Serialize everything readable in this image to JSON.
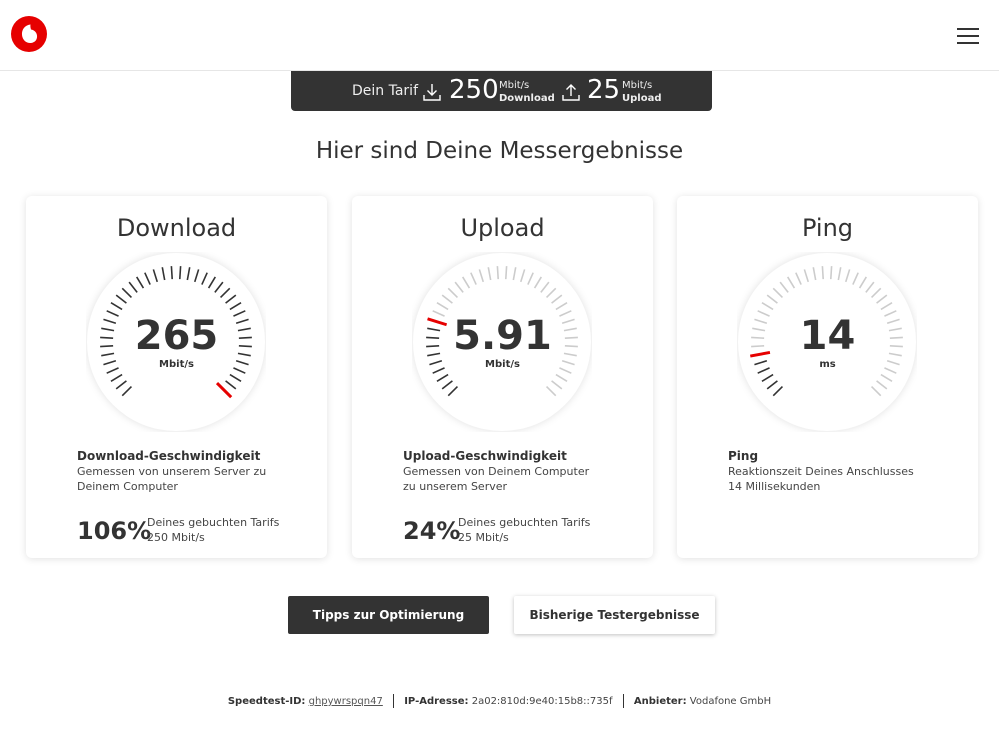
{
  "header": {
    "logo": "vodafone-logo",
    "menu_icon": "hamburger-icon"
  },
  "tariff": {
    "label": "Dein Tarif",
    "download_value": "250",
    "download_unit": "Mbit/s",
    "download_label": "Download",
    "upload_value": "25",
    "upload_unit": "Mbit/s",
    "upload_label": "Upload"
  },
  "headline": "Hier sind Deine Messergebnisse",
  "cards": [
    {
      "title": "Download",
      "value": "265",
      "unit": "Mbit/s",
      "gauge_level": 1.0,
      "heading": "Download-Geschwindigkeit",
      "description": "Gemessen von unserem Server zu Deinem Computer",
      "percent": "106%",
      "percent_label": "Deines gebuchten Tarifs",
      "percent_sub": "250 Mbit/s"
    },
    {
      "title": "Upload",
      "value": "5.91",
      "unit": "Mbit/s",
      "gauge_level": 0.24,
      "heading": "Upload-Geschwindigkeit",
      "description": "Gemessen von Deinem Computer zu unserem Server",
      "percent": "24%",
      "percent_label": "Deines gebuchten Tarifs",
      "percent_sub": "25 Mbit/s"
    },
    {
      "title": "Ping",
      "value": "14",
      "unit": "ms",
      "gauge_level": 0.14,
      "heading": "Ping",
      "description": "Reaktionszeit Deines Anschlusses 14 Millisekunden",
      "percent": "",
      "percent_label": "",
      "percent_sub": ""
    }
  ],
  "buttons": {
    "tips": "Tipps zur Optimierung",
    "history": "Bisherige Testergebnisse"
  },
  "footer": {
    "id_label": "Speedtest-ID:",
    "id_value": "ghpywrspqn47",
    "ip_label": "IP-Adresse:",
    "ip_value": "2a02:810d:9e40:15b8::735f",
    "provider_label": "Anbieter:",
    "provider_value": "Vodafone GmbH"
  },
  "colors": {
    "accent": "#e60000",
    "dark": "#333333",
    "tick_inactive": "#cccccc"
  }
}
